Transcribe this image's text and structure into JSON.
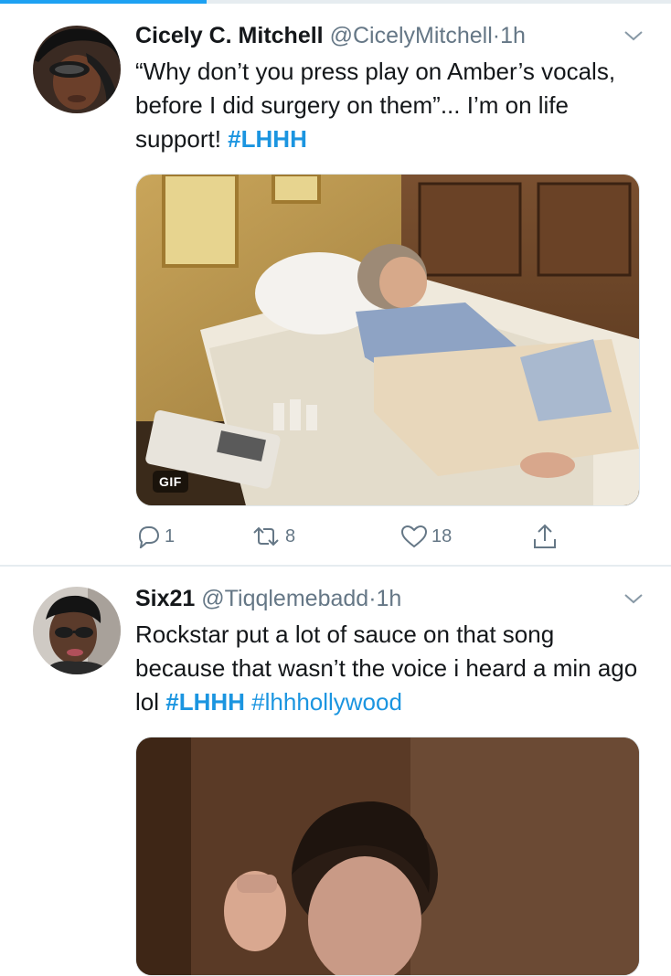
{
  "tweets": [
    {
      "name": "Cicely  C. Mitchell",
      "handle": "@CicelyMitchell",
      "separator": "·",
      "time": "1h",
      "text_parts": [
        "“Why don’t you press play on Amber’s vocals,  before I did surgery on them”... I’m on life support!  "
      ],
      "hashtags": [
        "#LHHH"
      ],
      "media": {
        "type": "gif",
        "badge": "GIF"
      },
      "actions": {
        "reply": "1",
        "retweet": "8",
        "like": "18"
      },
      "icons": [
        "chevron-down-icon",
        "reply-icon",
        "retweet-icon",
        "like-icon",
        "share-icon"
      ]
    },
    {
      "name": "Six21",
      "handle": "@Tiqqlemebadd",
      "separator": "·",
      "time": "1h",
      "text_parts": [
        "Rockstar put a lot of sauce on that song because that wasn’t the voice i heard a min ago lol "
      ],
      "hashtags": [
        "#LHHH",
        "#lhhhollywood"
      ],
      "icons": [
        "chevron-down-icon"
      ]
    }
  ],
  "colors": {
    "link": "#1b95e0",
    "secondary_text": "#657786",
    "divider": "#e6ecf0",
    "accent_bar": "#1da1f2"
  }
}
